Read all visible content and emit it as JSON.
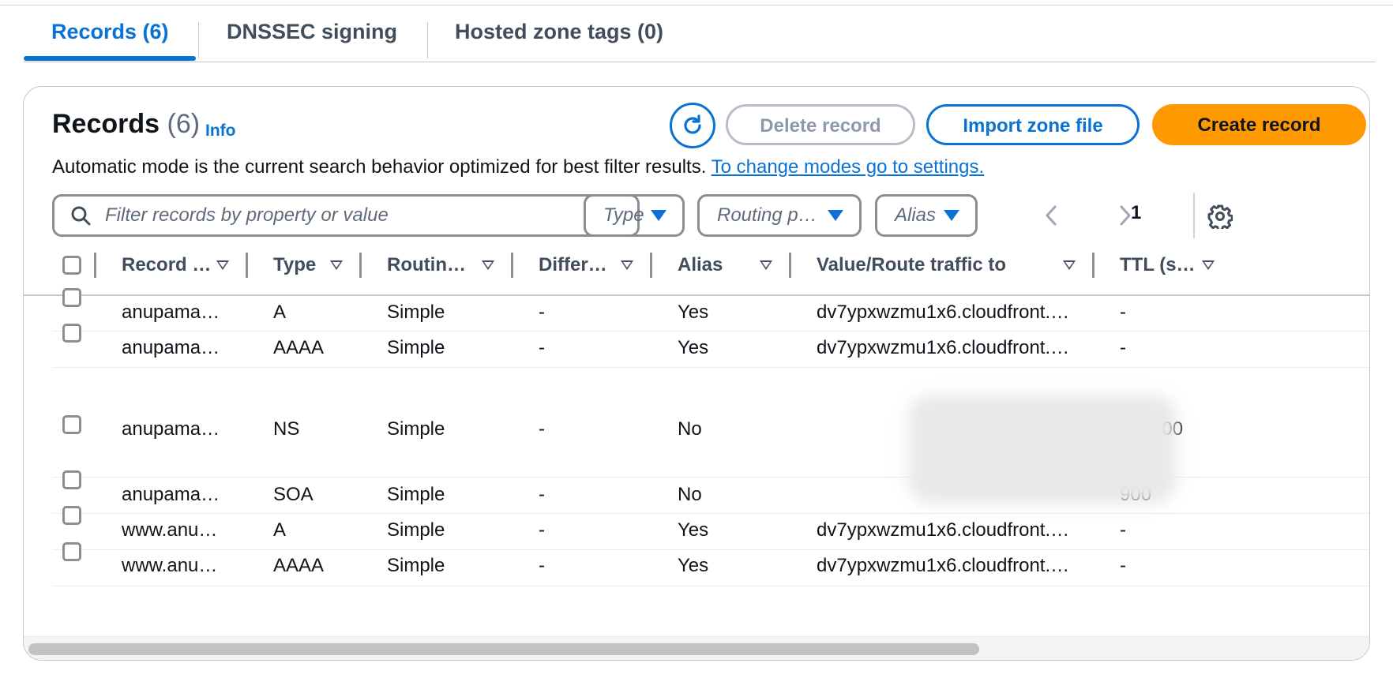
{
  "tabs": [
    {
      "label": "Records (6)",
      "active": true
    },
    {
      "label": "DNSSEC signing",
      "active": false
    },
    {
      "label": "Hosted zone tags (0)",
      "active": false
    }
  ],
  "header": {
    "title": "Records",
    "count": "(6)",
    "info": "Info",
    "description": "Automatic mode is the current search behavior optimized for best filter results.",
    "settings_link": "To change modes go to settings."
  },
  "actions": {
    "refresh_icon": "refresh-icon",
    "delete": "Delete record",
    "import": "Import zone file",
    "create": "Create record"
  },
  "filters": {
    "search_placeholder": "Filter records by property or value",
    "type": "Type",
    "routing": "Routing p…",
    "alias": "Alias"
  },
  "pagination": {
    "current_page": "1"
  },
  "table": {
    "columns": [
      "Record …",
      "Type",
      "Routin…",
      "Differ…",
      "Alias",
      "Value/Route traffic to",
      "TTL (s…"
    ],
    "rows": [
      {
        "name": "anupama…",
        "type": "A",
        "routing": "Simple",
        "differentiator": "-",
        "alias": "Yes",
        "value": "dv7ypxwzmu1x6.cloudfront.…",
        "ttl": "-"
      },
      {
        "name": "anupama…",
        "type": "AAAA",
        "routing": "Simple",
        "differentiator": "-",
        "alias": "Yes",
        "value": "dv7ypxwzmu1x6.cloudfront.…",
        "ttl": "-"
      },
      {
        "name": "anupama…",
        "type": "NS",
        "routing": "Simple",
        "differentiator": "-",
        "alias": "No",
        "value": "",
        "ttl": "172800"
      },
      {
        "name": "anupama…",
        "type": "SOA",
        "routing": "Simple",
        "differentiator": "-",
        "alias": "No",
        "value": "",
        "ttl": "900"
      },
      {
        "name": "www.anu…",
        "type": "A",
        "routing": "Simple",
        "differentiator": "-",
        "alias": "Yes",
        "value": "dv7ypxwzmu1x6.cloudfront.…",
        "ttl": "-"
      },
      {
        "name": "www.anu…",
        "type": "AAAA",
        "routing": "Simple",
        "differentiator": "-",
        "alias": "Yes",
        "value": "dv7ypxwzmu1x6.cloudfront.…",
        "ttl": "-"
      }
    ]
  },
  "colors": {
    "accent": "#0972d3",
    "primary_button": "#ff9900"
  }
}
